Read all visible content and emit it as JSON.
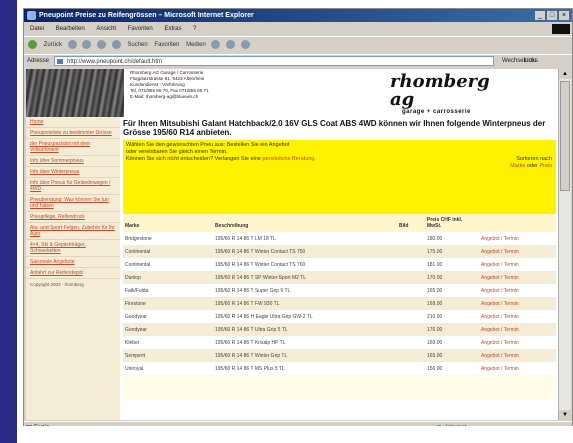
{
  "window": {
    "title": "Pneupoint Preise zu Reifengrössen – Microsoft Internet Explorer",
    "controls": [
      "_",
      "□",
      "×"
    ]
  },
  "menu": [
    "Datei",
    "Bearbeiten",
    "Ansicht",
    "Favoriten",
    "Extras",
    "?"
  ],
  "toolbar": {
    "back": "Zurück",
    "search": "Suchen",
    "favorites": "Favoriten",
    "media": "Medien"
  },
  "address": {
    "label": "Adresse",
    "url": "http://www.pneupoint.ch/default.htm",
    "go": "Wechseln zu",
    "links": "Links"
  },
  "header": {
    "address_lines": [
      "Rhomberg AG Garage / Carrosserie",
      "Flugplatzstrasse 81, 9423 Altenrhein",
      "Kundendienst · Vorführung",
      "Tel. 071/855 65 70, Fax 071/855 65 71",
      "E-Mail: rhomberg-ag@bluewin.ch"
    ],
    "brand_name": "rhomberg ag",
    "brand_sub": "garage + carrosserie"
  },
  "sidebar": {
    "items": [
      "Home",
      "Pneupreisliste zu bestimmter Grösse",
      "der Pneuspezialist mit dem Vollsortiment",
      "Info über Sommerpneus",
      "Info über Winterpneus",
      "Info über Pneus für Geländewagen / 4WD",
      "Pneuberatung: Was können Sie tun und haben",
      "Pneupflege, Reifendruck",
      "Alu- und Sport-Felgen, Zubehör für Ihr Auto",
      "4×4, Ski & Gepäckträger, Schneeketten",
      "Saisonale Angebote",
      "Anfahrt zur Reifendepot"
    ],
    "copyright": "Copyright 2003 · rhomberg"
  },
  "main": {
    "headline": "Für Ihren Mitsubishi Galant Hatchback/2.0 16V GLS Coat ABS 4WD können wir Ihnen folgende Winterpneus der Grösse 195/60 R14 anbieten.",
    "notice_line1": "Wählen Sie den gewünschten Pneu aus: Bestellen Sie ein Angebot",
    "notice_line2": "oder vereinbaren Sie gleich einen Termin.",
    "notice_line3": "Können Sie sich nicht entscheiden? Verlangen Sie eine",
    "notice_link": "persönliche Beratung.",
    "sort_label": "Sortieren nach",
    "sort_link1": "Marke",
    "sort_or": "oder",
    "sort_link2": "Preis"
  },
  "table": {
    "headers": [
      "Marke",
      "Beschreibung",
      "Bild",
      "Preis CHF inkl. MwSt.",
      ""
    ],
    "rows": [
      [
        "Bridgestone",
        "195/60 R 14 86 T LM 18 TL",
        "",
        "180.00",
        "Angebot / Termin"
      ],
      [
        "Continental",
        "195/60 R 14 86 T Winter Contact TS 750",
        "",
        "175.00",
        "Angebot / Termin"
      ],
      [
        "Continental",
        "195/60 R 14 86 T Winter Contact TS 760",
        "",
        "181.00",
        "Angebot / Termin"
      ],
      [
        "Dunlop",
        "195/60 R 14 86 T SP Winter Sport M2 TL",
        "",
        "170.00",
        "Angebot / Termin"
      ],
      [
        "Falk/Fulda",
        "195/60 R 14 86 T Super Grip 9 TL",
        "",
        "165.00",
        "Angebot / Termin"
      ],
      [
        "Firestone",
        "195/60 R 14 86 T FW 930 TL",
        "",
        "169.00",
        "Angebot / Termin"
      ],
      [
        "Goodyear",
        "195/60 R 14 86 H Eagle Ultra Grip GW-2 TL",
        "",
        "210.00",
        "Angebot / Termin"
      ],
      [
        "Goodyear",
        "195/60 R 14 86 T Ultra Grip 5 TL",
        "",
        "176.00",
        "Angebot / Termin"
      ],
      [
        "Kléber",
        "195/60 R 14 86 T Krisalp HP TL",
        "",
        "169.00",
        "Angebot / Termin"
      ],
      [
        "Semperit",
        "195/60 R 14 86 T Winter Grip TL",
        "",
        "165.00",
        "Angebot / Termin"
      ],
      [
        "Uniroyal",
        "195/60 R 14 86 T MS Plus 5 TL",
        "",
        "156.00",
        "Angebot / Termin"
      ]
    ]
  },
  "status": {
    "left": "Fertig",
    "right": "Internet"
  }
}
